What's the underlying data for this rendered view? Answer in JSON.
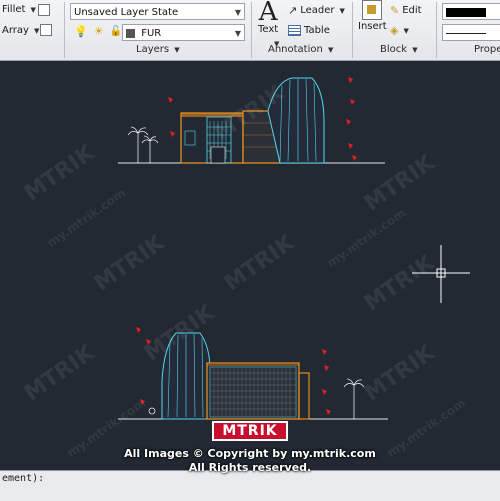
{
  "ribbon": {
    "modify": {
      "fillet_label": "Fillet",
      "array_label": "Array"
    },
    "layers": {
      "layer_state": "Unsaved Layer State",
      "current_layer": "FUR",
      "panel_label": "Layers"
    },
    "annotation": {
      "text_label": "Text",
      "leader_label": "Leader",
      "table_label": "Table",
      "panel_label": "Annotation"
    },
    "block": {
      "insert_label": "Insert",
      "edit_label": "Edit",
      "panel_label": "Block"
    },
    "properties": {
      "panel_label": "Prope"
    }
  },
  "watermark": {
    "brand": "MTRIK",
    "site": "my.mtrik.com",
    "copyright_line1": "All Images © Copyright by my.mtrik.com",
    "copyright_line2": "All Rights reserved."
  },
  "command_line": {
    "prompt": "ement):"
  },
  "colors": {
    "canvas": "#222933",
    "building_orange": "#e28a1e",
    "glass_cyan": "#54d6f0",
    "tree_white": "#e8e8e8",
    "marker_red": "#e02020"
  }
}
